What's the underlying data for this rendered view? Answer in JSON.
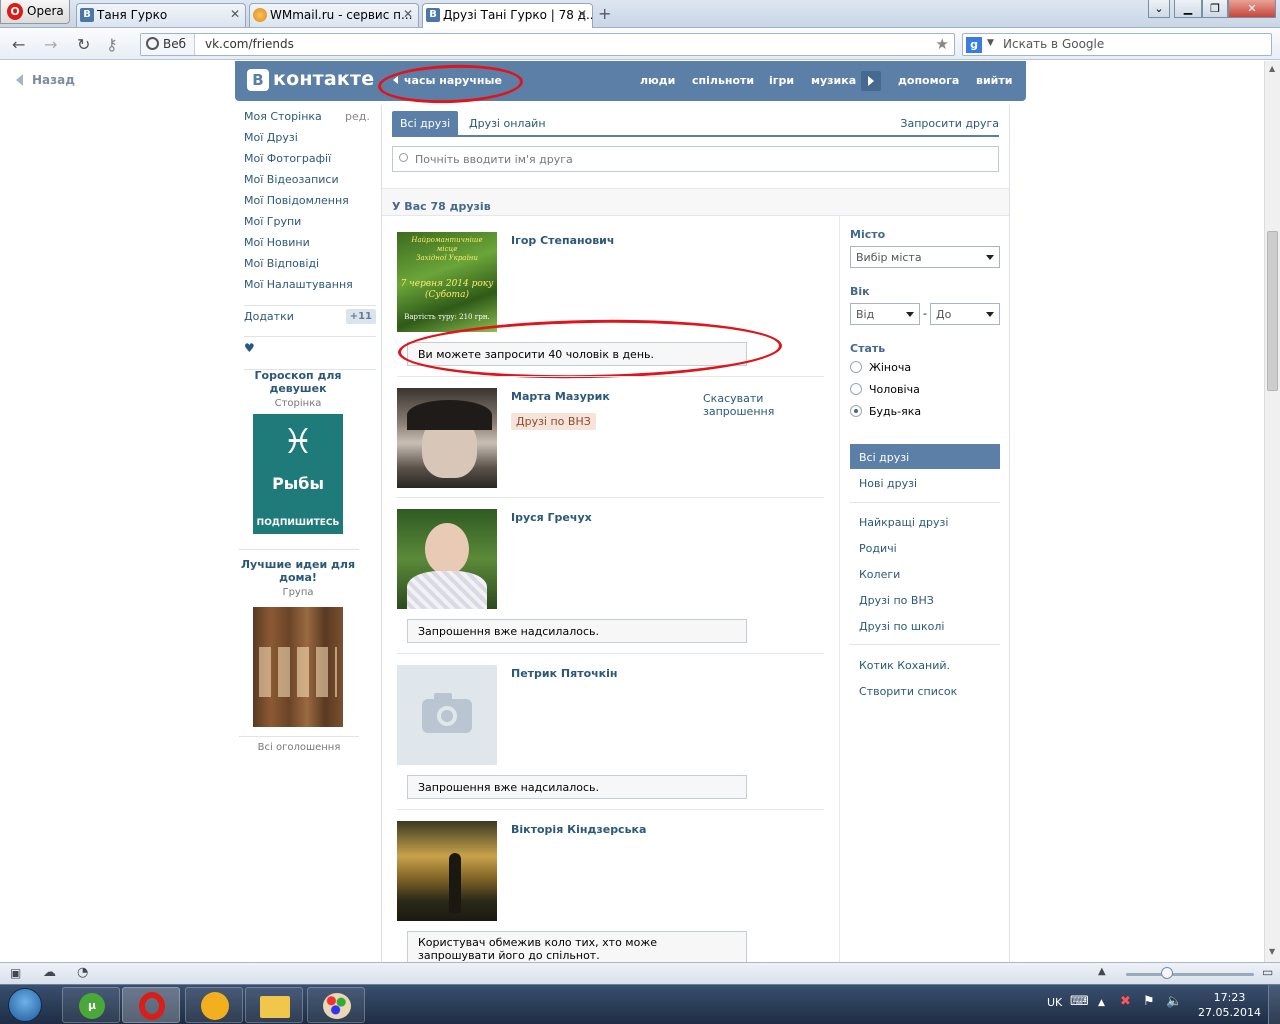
{
  "browser": {
    "menu_label": "Opera",
    "tabs": [
      {
        "title": "Таня Гурко",
        "icon": "vk-icon"
      },
      {
        "title": "WMmail.ru - сервис п...",
        "icon": "wmmail-icon"
      },
      {
        "title": "Друзі Тані Гурко | 78 д...",
        "icon": "vk-icon",
        "active": true
      }
    ],
    "web_label": "Веб",
    "url": "vk.com/friends",
    "search_placeholder": "Искать в Google"
  },
  "page": {
    "back_label": "Назад",
    "header": {
      "logo_text": "контакте",
      "logo_letter": "В",
      "status": "часы наручные",
      "nav": [
        "люди",
        "спільноти",
        "ігри",
        "музика",
        "допомога",
        "вийти"
      ]
    },
    "left_menu": {
      "items": [
        "Моя Сторінка",
        "Мої Друзі",
        "Мої Фотографії",
        "Мої Відеозаписи",
        "Мої Повідомлення",
        "Мої Групи",
        "Мої Новини",
        "Мої Відповіді",
        "Мої Налаштування"
      ],
      "edit_label": "ред.",
      "addons_label": "Додатки",
      "addons_count": "+11",
      "heart": "♥"
    },
    "ads": [
      {
        "title": "Гороскоп для девушек",
        "subtitle": "Сторінка",
        "image_text": "Рыбы",
        "image_button": "ПОДПИШИТЕСЬ",
        "symbol": "♓"
      },
      {
        "title": "Лучшие идеи для дома!",
        "subtitle": "Група"
      }
    ],
    "all_ads_label": "Всі оголошення",
    "tabs": [
      {
        "label": "Всі друзі",
        "active": true
      },
      {
        "label": "Друзі онлайн"
      }
    ],
    "invite_link": "Запросити друга",
    "search_placeholder": "Почніть вводити ім'я друга",
    "friends_count_label": "У Вас 78 друзів",
    "friends": [
      {
        "name": "Ігор Степанович",
        "note": "Ви можете запросити 40 чоловік в день.",
        "photo_text": [
          "Найромантичніше місце",
          "Західної України",
          "7 червня 2014 року",
          "(Субота)",
          "Вартість туру: 210 грн."
        ]
      },
      {
        "name": "Марта Мазурик",
        "badge": "Друзі по ВНЗ",
        "cancel": "Скасувати запрошення"
      },
      {
        "name": "Іруся Гречух",
        "note": "Запрошення вже надсилалось."
      },
      {
        "name": "Петрик Пяточкін",
        "note": "Запрошення вже надсилалось."
      },
      {
        "name": "Вікторія Кіндзерська",
        "note": "Користувач обмежив коло тих, хто може запрошувати його до спільнот."
      }
    ],
    "filters": {
      "city_label": "Місто",
      "city_select": "Вибір міста",
      "age_label": "Вік",
      "age_from": "Від",
      "age_to": "До",
      "age_dash": "-",
      "sex_label": "Стать",
      "sex_options": [
        {
          "label": "Жіноча",
          "checked": false
        },
        {
          "label": "Чоловіча",
          "checked": false
        },
        {
          "label": "Будь-яка",
          "checked": true
        }
      ],
      "lists": [
        "Всі друзі",
        "Нові друзі"
      ],
      "groups": [
        "Найкращі друзі",
        "Родичі",
        "Колеги",
        "Друзі по ВНЗ",
        "Друзі по школі"
      ],
      "custom": [
        "Котик Коханий.",
        "Створити список"
      ]
    }
  },
  "taskbar": {
    "lang": "UK",
    "time": "17:23",
    "date": "27.05.2014"
  }
}
